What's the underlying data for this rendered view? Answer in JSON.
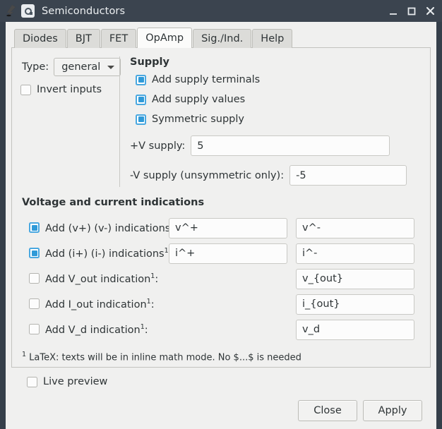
{
  "window": {
    "title": "Semiconductors",
    "app_icon": "inkscape-logo-icon",
    "controls": {
      "minimize": "minimize-icon",
      "maximize": "maximize-icon",
      "close": "close-icon"
    }
  },
  "tabs": [
    {
      "label": "Diodes",
      "active": false
    },
    {
      "label": "BJT",
      "active": false
    },
    {
      "label": "FET",
      "active": false
    },
    {
      "label": "OpAmp",
      "active": true
    },
    {
      "label": "Sig./Ind.",
      "active": false
    },
    {
      "label": "Help",
      "active": false
    }
  ],
  "left": {
    "type_label": "Type:",
    "type_value": "general",
    "invert_inputs_label": "Invert inputs",
    "invert_inputs_checked": false
  },
  "supply": {
    "heading": "Supply",
    "checkboxes": [
      {
        "label": "Add supply terminals",
        "checked": true
      },
      {
        "label": "Add supply values",
        "checked": true
      },
      {
        "label": "Symmetric supply",
        "checked": true
      }
    ],
    "pos_label": "+V supply:",
    "pos_value": "5",
    "neg_label": "-V supply (unsymmetric only):",
    "neg_value": "-5"
  },
  "indications": {
    "heading": "Voltage and current indications",
    "rows": [
      {
        "label": "Add (v+) (v-) indications",
        "sup": "1",
        "suffix": ":",
        "checked": true,
        "field1": "v^+",
        "field2": "v^-",
        "two_fields": true
      },
      {
        "label": "Add (i+) (i-) indications",
        "sup": "1",
        "suffix": ":",
        "checked": true,
        "field1": "i^+",
        "field2": "i^-",
        "two_fields": true
      },
      {
        "label": "Add V_out indication",
        "sup": "1",
        "suffix": ":",
        "checked": false,
        "field1": "",
        "field2": "v_{out}",
        "two_fields": false
      },
      {
        "label": "Add I_out indication",
        "sup": "1",
        "suffix": ":",
        "checked": false,
        "field1": "",
        "field2": "i_{out}",
        "two_fields": false
      },
      {
        "label": "Add V_d indication",
        "sup": "1",
        "suffix": ":",
        "checked": false,
        "field1": "",
        "field2": "v_d",
        "two_fields": false
      }
    ],
    "footnote_sup": "1",
    "footnote": " LaTeX: texts will be in inline math mode. No $...$ is needed"
  },
  "bottom": {
    "live_preview_label": "Live preview",
    "live_preview_checked": false,
    "close_label": "Close",
    "apply_label": "Apply"
  },
  "colors": {
    "titlebar": "#3b444f",
    "window_frame": "#353f4a",
    "client_bg": "#f0f0ef",
    "accent_checkbox": "#2f9ad8",
    "accent_checkbox_border": "#4aa8e0",
    "field_bg": "#fcfcfc",
    "tab_active_bg": "#fbfbfa",
    "tab_inactive_bg": "#dcdcd9"
  }
}
